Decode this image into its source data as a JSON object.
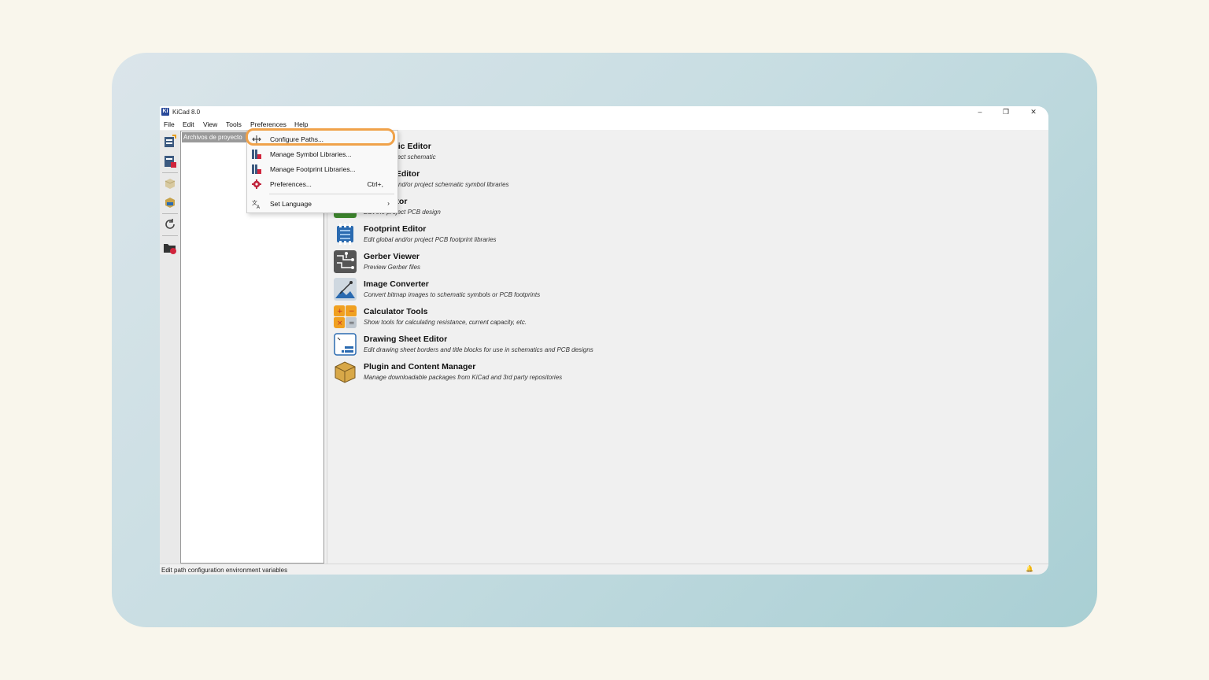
{
  "window": {
    "title": "KiCad 8.0",
    "app_icon": "Ki"
  },
  "window_controls": {
    "minimize": "–",
    "restore": "❐",
    "close": "✕"
  },
  "menubar": [
    "File",
    "Edit",
    "View",
    "Tools",
    "Preferences",
    "Help"
  ],
  "tree": {
    "header": "Archivos de proyecto"
  },
  "tools": [
    {
      "name": "Schematic Editor",
      "desc": "Edit the project schematic",
      "icon": "schematic-editor-icon"
    },
    {
      "name": "Symbol Editor",
      "desc": "Edit global and/or project schematic symbol libraries",
      "icon": "symbol-editor-icon"
    },
    {
      "name": "PCB Editor",
      "desc": "Edit the project PCB design",
      "icon": "pcb-editor-icon"
    },
    {
      "name": "Footprint Editor",
      "desc": "Edit global and/or project PCB footprint libraries",
      "icon": "footprint-editor-icon"
    },
    {
      "name": "Gerber Viewer",
      "desc": "Preview Gerber files",
      "icon": "gerber-viewer-icon"
    },
    {
      "name": "Image Converter",
      "desc": "Convert bitmap images to schematic symbols or PCB footprints",
      "icon": "image-converter-icon"
    },
    {
      "name": "Calculator Tools",
      "desc": "Show tools for calculating resistance, current capacity, etc.",
      "icon": "calculator-tools-icon"
    },
    {
      "name": "Drawing Sheet Editor",
      "desc": "Edit drawing sheet borders and title blocks for use in schematics and PCB designs",
      "icon": "drawing-sheet-editor-icon"
    },
    {
      "name": "Plugin and Content Manager",
      "desc": "Manage downloadable packages from KiCad and 3rd party repositories",
      "icon": "plugin-manager-icon"
    }
  ],
  "dropdown": {
    "items": [
      {
        "label": "Configure Paths...",
        "shortcut": "",
        "icon": "configure-paths-icon"
      },
      {
        "label": "Manage Symbol Libraries...",
        "shortcut": "",
        "icon": "symbol-library-icon"
      },
      {
        "label": "Manage Footprint Libraries...",
        "shortcut": "",
        "icon": "footprint-library-icon"
      },
      {
        "label": "Preferences...",
        "shortcut": "Ctrl+,",
        "icon": "gear-icon"
      },
      {
        "label": "Set Language",
        "shortcut": "",
        "icon": "language-icon"
      }
    ],
    "submenu_arrow": "›"
  },
  "statusbar": {
    "text": "Edit path configuration environment variables",
    "bell": "🔔"
  },
  "colors": {
    "highlight": "#f0a24a",
    "accent_blue": "#2a6ab0"
  }
}
